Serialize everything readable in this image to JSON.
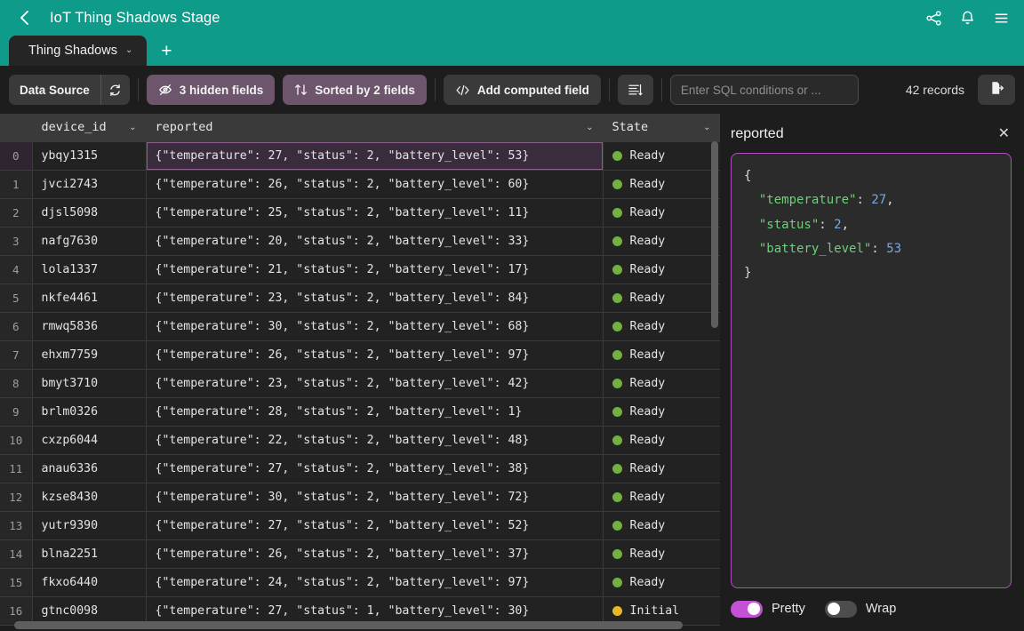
{
  "titlebar": {
    "back_icon": "chevron-left-icon",
    "title": "IoT Thing Shadows Stage",
    "icons": [
      "share-icon",
      "bell-icon",
      "menu-icon"
    ]
  },
  "tabs": {
    "items": [
      {
        "label": "Thing Shadows",
        "caret": "⌄",
        "active": true
      }
    ],
    "new_tab_label": "+"
  },
  "toolbar": {
    "data_source_label": "Data Source",
    "refresh_icon": "refresh-icon",
    "hidden_fields_label": "3 hidden fields",
    "hidden_fields_icon": "eye-off-icon",
    "sorted_label": "Sorted by 2 fields",
    "sorted_icon": "sort-arrows-icon",
    "computed_field_label": "Add computed field",
    "computed_field_icon": "code-brackets-icon",
    "row_height_icon": "row-height-icon",
    "sql_placeholder": "Enter SQL conditions or ...",
    "sql_value": "",
    "records_label": "42 records",
    "export_icon": "export-file-icon"
  },
  "grid": {
    "columns": [
      {
        "key": "rownum",
        "label": "",
        "caret": ""
      },
      {
        "key": "device_id",
        "label": "device_id",
        "caret": "⌄"
      },
      {
        "key": "reported",
        "label": "reported",
        "caret": "⌄"
      },
      {
        "key": "state",
        "label": "State",
        "caret": "⌄"
      }
    ],
    "state_colors": {
      "Ready": "#72b043",
      "Initial": "#e8b62c"
    },
    "rows": [
      {
        "n": "0",
        "device_id": "ybqy1315",
        "reported": "{\"temperature\": 27, \"status\": 2, \"battery_level\": 53}",
        "state": "Ready",
        "selected": true
      },
      {
        "n": "1",
        "device_id": "jvci2743",
        "reported": "{\"temperature\": 26, \"status\": 2, \"battery_level\": 60}",
        "state": "Ready",
        "selected": false
      },
      {
        "n": "2",
        "device_id": "djsl5098",
        "reported": "{\"temperature\": 25, \"status\": 2, \"battery_level\": 11}",
        "state": "Ready",
        "selected": false
      },
      {
        "n": "3",
        "device_id": "nafg7630",
        "reported": "{\"temperature\": 20, \"status\": 2, \"battery_level\": 33}",
        "state": "Ready",
        "selected": false
      },
      {
        "n": "4",
        "device_id": "lola1337",
        "reported": "{\"temperature\": 21, \"status\": 2, \"battery_level\": 17}",
        "state": "Ready",
        "selected": false
      },
      {
        "n": "5",
        "device_id": "nkfe4461",
        "reported": "{\"temperature\": 23, \"status\": 2, \"battery_level\": 84}",
        "state": "Ready",
        "selected": false
      },
      {
        "n": "6",
        "device_id": "rmwq5836",
        "reported": "{\"temperature\": 30, \"status\": 2, \"battery_level\": 68}",
        "state": "Ready",
        "selected": false
      },
      {
        "n": "7",
        "device_id": "ehxm7759",
        "reported": "{\"temperature\": 26, \"status\": 2, \"battery_level\": 97}",
        "state": "Ready",
        "selected": false
      },
      {
        "n": "8",
        "device_id": "bmyt3710",
        "reported": "{\"temperature\": 23, \"status\": 2, \"battery_level\": 42}",
        "state": "Ready",
        "selected": false
      },
      {
        "n": "9",
        "device_id": "brlm0326",
        "reported": "{\"temperature\": 28, \"status\": 2, \"battery_level\": 1}",
        "state": "Ready",
        "selected": false
      },
      {
        "n": "10",
        "device_id": "cxzp6044",
        "reported": "{\"temperature\": 22, \"status\": 2, \"battery_level\": 48}",
        "state": "Ready",
        "selected": false
      },
      {
        "n": "11",
        "device_id": "anau6336",
        "reported": "{\"temperature\": 27, \"status\": 2, \"battery_level\": 38}",
        "state": "Ready",
        "selected": false
      },
      {
        "n": "12",
        "device_id": "kzse8430",
        "reported": "{\"temperature\": 30, \"status\": 2, \"battery_level\": 72}",
        "state": "Ready",
        "selected": false
      },
      {
        "n": "13",
        "device_id": "yutr9390",
        "reported": "{\"temperature\": 27, \"status\": 2, \"battery_level\": 52}",
        "state": "Ready",
        "selected": false
      },
      {
        "n": "14",
        "device_id": "blna2251",
        "reported": "{\"temperature\": 26, \"status\": 2, \"battery_level\": 37}",
        "state": "Ready",
        "selected": false
      },
      {
        "n": "15",
        "device_id": "fkxo6440",
        "reported": "{\"temperature\": 24, \"status\": 2, \"battery_level\": 97}",
        "state": "Ready",
        "selected": false
      },
      {
        "n": "16",
        "device_id": "gtnc0098",
        "reported": "{\"temperature\": 27, \"status\": 1, \"battery_level\": 30}",
        "state": "Initial",
        "selected": false
      }
    ]
  },
  "panel": {
    "title": "reported",
    "close_icon": "close-icon",
    "json_lines": [
      {
        "parts": [
          {
            "t": "{",
            "c": "punc"
          }
        ]
      },
      {
        "parts": [
          {
            "t": "  \"temperature\"",
            "c": "key"
          },
          {
            "t": ": ",
            "c": "punc"
          },
          {
            "t": "27",
            "c": "num"
          },
          {
            "t": ",",
            "c": "punc"
          }
        ]
      },
      {
        "parts": [
          {
            "t": "  \"status\"",
            "c": "key"
          },
          {
            "t": ": ",
            "c": "punc"
          },
          {
            "t": "2",
            "c": "num"
          },
          {
            "t": ",",
            "c": "punc"
          }
        ]
      },
      {
        "parts": [
          {
            "t": "  \"battery_level\"",
            "c": "key"
          },
          {
            "t": ": ",
            "c": "punc"
          },
          {
            "t": "53",
            "c": "num"
          }
        ]
      },
      {
        "parts": [
          {
            "t": "}",
            "c": "punc"
          }
        ]
      }
    ],
    "pretty_label": "Pretty",
    "pretty_on": true,
    "wrap_label": "Wrap",
    "wrap_on": false
  },
  "colors": {
    "accent_teal": "#0e9b8a",
    "accent_purple": "#c451d6",
    "button_purple": "#6d566b",
    "selection_border": "#b14fc0"
  }
}
